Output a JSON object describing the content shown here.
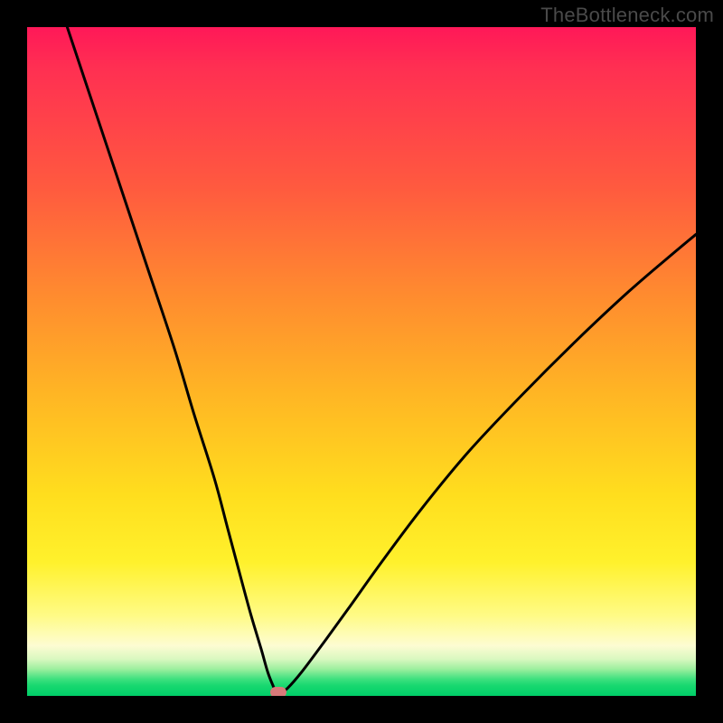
{
  "watermark": "TheBottleneck.com",
  "colors": {
    "frame": "#000000",
    "curve": "#000000",
    "marker": "#d87a7a",
    "gradient_top": "#ff1858",
    "gradient_mid": "#ffde1e",
    "gradient_bottom": "#00ce68"
  },
  "chart_data": {
    "type": "line",
    "title": "",
    "xlabel": "",
    "ylabel": "",
    "xlim": [
      0,
      100
    ],
    "ylim": [
      0,
      100
    ],
    "grid": false,
    "legend": false,
    "annotations": [
      {
        "kind": "marker",
        "x": 37.5,
        "y": 0,
        "shape": "rounded-rect",
        "color": "#d87a7a"
      }
    ],
    "series": [
      {
        "name": "left-branch",
        "x": [
          6,
          10,
          14,
          18,
          22,
          25,
          28,
          30,
          32,
          33.5,
          35,
          36,
          37,
          37.5
        ],
        "values": [
          100,
          88,
          76,
          64,
          52,
          42,
          32.5,
          25,
          17.5,
          12,
          7,
          3.5,
          1,
          0
        ]
      },
      {
        "name": "right-branch",
        "x": [
          37.5,
          39,
          41,
          44,
          48,
          53,
          59,
          66,
          74,
          82,
          90,
          97,
          100
        ],
        "values": [
          0,
          1.2,
          3.5,
          7.5,
          13,
          20,
          28,
          36.5,
          45,
          53,
          60.5,
          66.5,
          69
        ]
      }
    ],
    "background_gradient": {
      "direction": "vertical",
      "stops": [
        {
          "pos": 0.0,
          "color": "#ff1858"
        },
        {
          "pos": 0.24,
          "color": "#ff5a3f"
        },
        {
          "pos": 0.55,
          "color": "#ffb624"
        },
        {
          "pos": 0.8,
          "color": "#fff12c"
        },
        {
          "pos": 0.93,
          "color": "#fdfcd2"
        },
        {
          "pos": 1.0,
          "color": "#00ce68"
        }
      ]
    }
  }
}
